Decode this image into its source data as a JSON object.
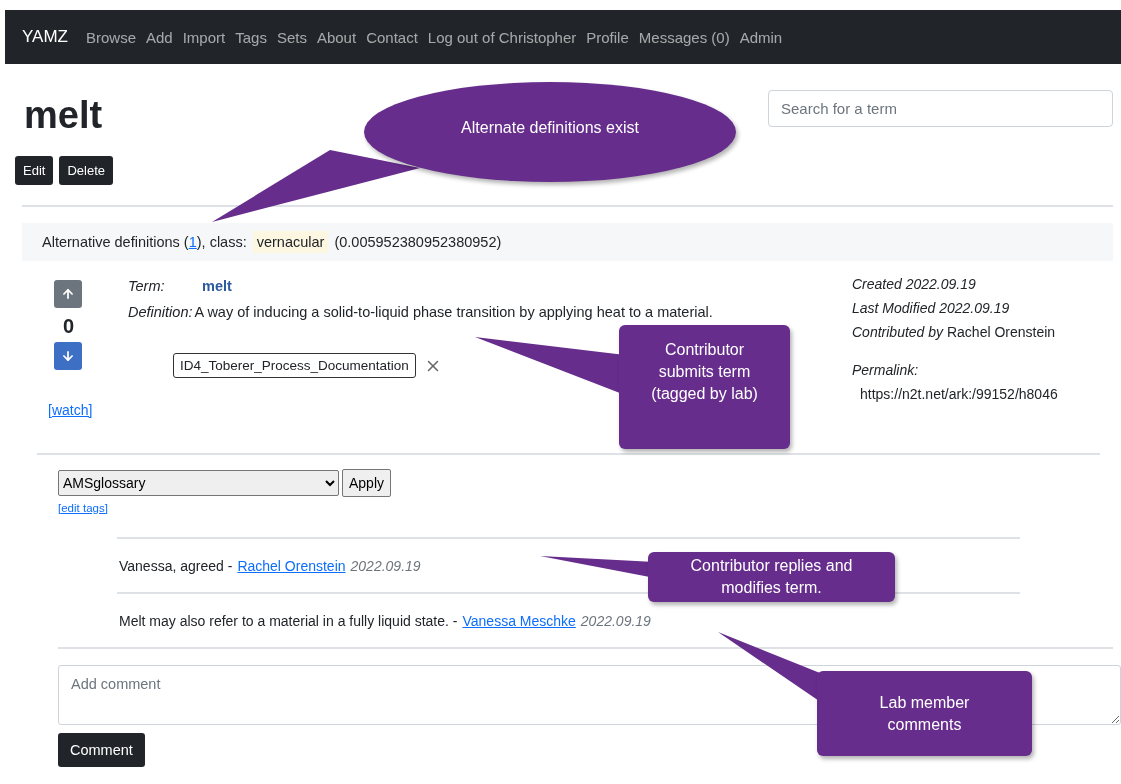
{
  "navbar": {
    "brand": "YAMZ",
    "items": [
      "Browse",
      "Add",
      "Import",
      "Tags",
      "Sets",
      "About",
      "Contact",
      "Log out of Christopher",
      "Profile",
      "Messages (0)",
      "Admin"
    ]
  },
  "term_title": "melt",
  "actions": [
    "Edit",
    "Delete"
  ],
  "search": {
    "placeholder": "Search for a term"
  },
  "alternatives": {
    "label_before": "Alternative definitions (",
    "count_link": "1",
    "label_after": "), class:",
    "class_tag": "vernacular",
    "score": "(0.005952380952380952)"
  },
  "vote": {
    "score": "0"
  },
  "watch": "[watch]",
  "term": {
    "term_label": "Term:",
    "term_value": "melt",
    "definition_label": "Definition:",
    "definition_text": "A way of inducing a solid-to-liquid phase transition by applying heat to a material.",
    "tag": "ID4_Toberer_Process_Documentation"
  },
  "meta": {
    "created_label": "Created",
    "created": "2022.09.19",
    "modified_label": "Last Modified",
    "modified": "2022.09.19",
    "contributed_label": "Contributed by",
    "contributor": "Rachel Orenstein",
    "permalink_label": "Permalink:",
    "permalink": "https://n2t.net/ark:/99152/h8046"
  },
  "tagging": {
    "selected_tag": "AMSglossary",
    "apply": "Apply",
    "edit_tags": "[edit tags]"
  },
  "comments": [
    {
      "text": "Vanessa, agreed -",
      "author": "Rachel Orenstein",
      "date": "2022.09.19"
    },
    {
      "text": "Melt may also refer to a material in a fully liquid state. -",
      "author": "Vanessa Meschke",
      "date": "2022.09.19"
    }
  ],
  "comment_form": {
    "placeholder": "Add comment",
    "submit": "Comment"
  },
  "callouts": [
    {
      "kind": "ellipse",
      "text": "Alternate definitions exist"
    },
    {
      "kind": "box",
      "text": "Contributor submits term (tagged by lab)"
    },
    {
      "kind": "box",
      "text": "Contributor replies and modifies term."
    },
    {
      "kind": "box",
      "text": "Lab member comments"
    }
  ]
}
